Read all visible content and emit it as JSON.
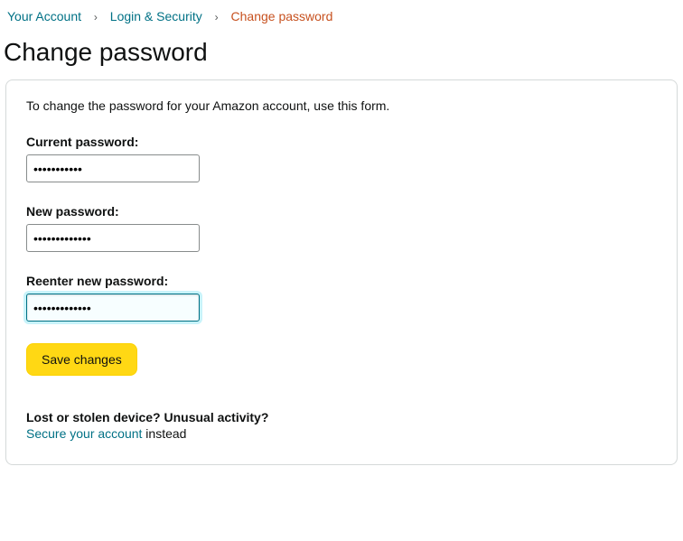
{
  "breadcrumb": {
    "your_account": "Your Account",
    "login_security": "Login & Security",
    "current": "Change password"
  },
  "page_title": "Change password",
  "card": {
    "instruction": "To change the password for your Amazon account, use this form.",
    "fields": {
      "current": {
        "label": "Current password:",
        "value": "•••••••••••"
      },
      "new": {
        "label": "New password:",
        "value": "•••••••••••••"
      },
      "reenter": {
        "label": "Reenter new password:",
        "value": "•••••••••••••"
      }
    },
    "save_button": "Save changes",
    "security": {
      "heading": "Lost or stolen device? Unusual activity?",
      "link_text": "Secure your account",
      "suffix": " instead"
    }
  }
}
